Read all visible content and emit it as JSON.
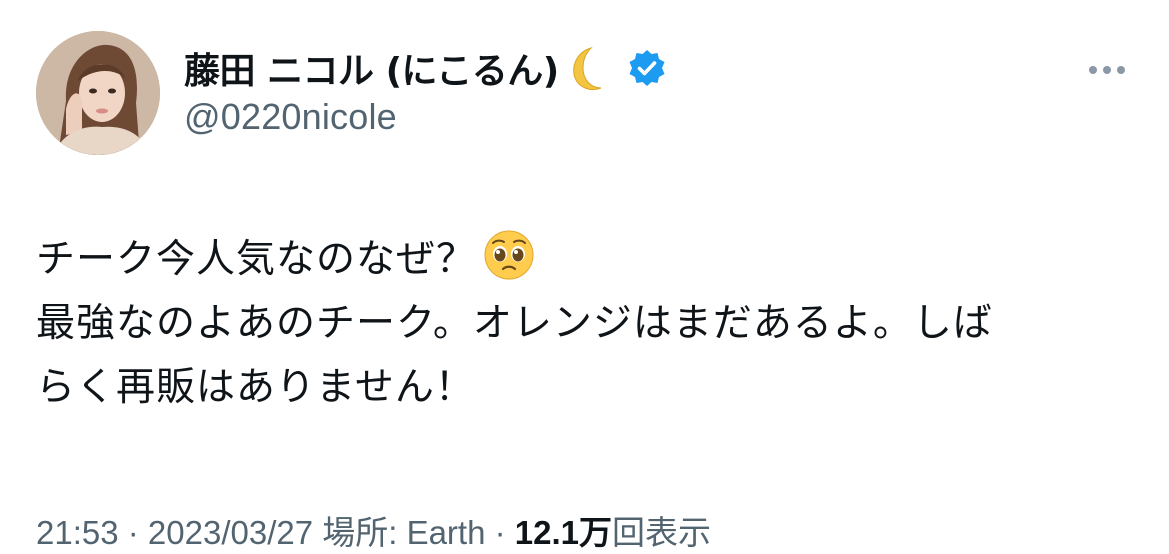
{
  "tweet": {
    "author": {
      "display_name": "藤田 ニコル (にこるん)",
      "name_emoji": "moon-icon",
      "verified": true,
      "verified_color": "#1d9bf0",
      "handle": "@0220nicole",
      "avatar": "avatar-photo"
    },
    "more_icon": "more-horizontal-icon",
    "text_lines": [
      "チーク今人気なのなぜ？",
      "最強なのよあのチーク。オレンジはまだあるよ。しば",
      "らく再販はありません！"
    ],
    "text_emoji": "pleading-face-icon",
    "meta": {
      "time_date": "21:53 · 2023/03/27 場所: Earth · ",
      "views_count": "12.1万",
      "views_label": "回表示"
    }
  }
}
